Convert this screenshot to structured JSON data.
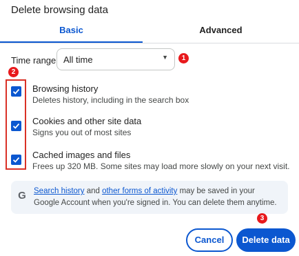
{
  "dialog": {
    "title": "Delete browsing data"
  },
  "tabs": [
    {
      "label": "Basic",
      "active": true
    },
    {
      "label": "Advanced",
      "active": false
    }
  ],
  "time_range": {
    "label": "Time range",
    "value": "All time"
  },
  "options": [
    {
      "title": "Browsing history",
      "desc": "Deletes history, including in the search box",
      "checked": true
    },
    {
      "title": "Cookies and other site data",
      "desc": "Signs you out of most sites",
      "checked": true
    },
    {
      "title": "Cached images and files",
      "desc": "Frees up 320 MB. Some sites may load more slowly on your next visit.",
      "checked": true
    }
  ],
  "info": {
    "icon": "google-g-icon",
    "link1": "Search history",
    "text1": " and ",
    "link2": "other forms of activity",
    "text2": " may be saved in your Google Account when you're signed in. You can delete them anytime."
  },
  "buttons": {
    "cancel": "Cancel",
    "delete": "Delete data"
  },
  "callouts": [
    "1",
    "2",
    "3"
  ],
  "colors": {
    "accent": "#0b57d0",
    "callout": "#e8191c",
    "highlight_box": "#d93025"
  }
}
